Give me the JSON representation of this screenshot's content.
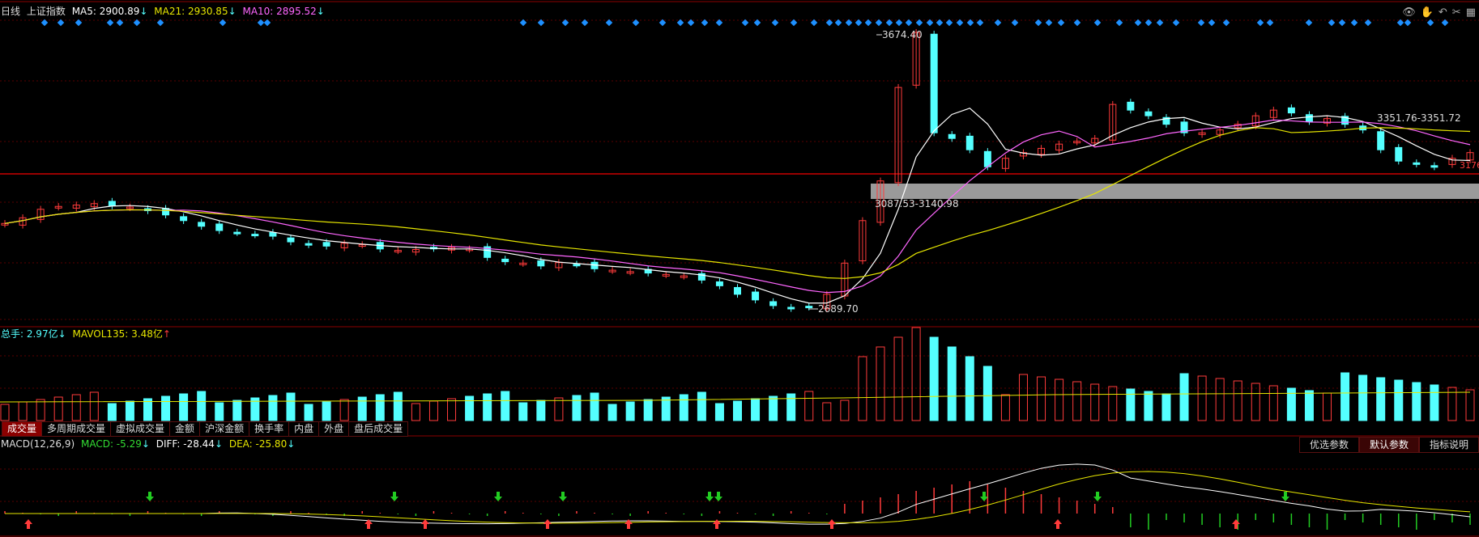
{
  "header": {
    "period": "日线",
    "index_name": "上证指数",
    "ma5_label": "MA5: 2900.89",
    "ma5_arrow": "↓",
    "ma21_label": "MA21: 2930.85",
    "ma21_arrow": "↓",
    "ma10_label": "MA10: 2895.52",
    "ma10_arrow": "↓"
  },
  "price_panel": {
    "high_label": "3674.40",
    "low_label": "2689.70",
    "gap_label": "3087.53-3140.98",
    "right_label": "3351.76-3351.72",
    "edge_label": "3176"
  },
  "volume_panel": {
    "total_label": "总手: 2.97亿",
    "total_arrow": "↓",
    "mavol_label": "MAVOL135: 3.48亿",
    "mavol_arrow": "↑"
  },
  "tabs": [
    "成交量",
    "多周期成交量",
    "虚拟成交量",
    "金额",
    "沪深金额",
    "换手率",
    "内盘",
    "外盘",
    "盘后成交量"
  ],
  "macd_panel": {
    "title": "MACD(12,26,9)",
    "macd_label": "MACD: -5.29",
    "macd_arrow": "↓",
    "diff_label": "DIFF: -28.44",
    "diff_arrow": "↓",
    "dea_label": "DEA: -25.80",
    "dea_arrow": "↓"
  },
  "param_buttons": {
    "optimize": "优选参数",
    "default": "默认参数",
    "explain": "指标说明"
  },
  "colors": {
    "up": "#ff3b3b",
    "down": "#54ffff",
    "ma5": "#ffffff",
    "ma10": "#ff66ff",
    "ma21": "#e6e600",
    "signal": "#1e90ff",
    "grid": "#5a0000"
  },
  "chart_data": {
    "type": "candlestick",
    "approx_closes": [
      3000,
      3020,
      3050,
      3060,
      3065,
      3070,
      3062,
      3058,
      3045,
      3030,
      3010,
      2990,
      2975,
      2968,
      2960,
      2955,
      2935,
      2925,
      2920,
      2930,
      2925,
      2910,
      2905,
      2908,
      2912,
      2915,
      2910,
      2880,
      2865,
      2860,
      2850,
      2862,
      2855,
      2840,
      2835,
      2830,
      2825,
      2820,
      2815,
      2800,
      2780,
      2750,
      2730,
      2710,
      2700,
      2705,
      2750,
      2860,
      3010,
      3150,
      3480,
      3674,
      3320,
      3300,
      3260,
      3200,
      3230,
      3250,
      3265,
      3280,
      3290,
      3300,
      3420,
      3400,
      3380,
      3350,
      3320,
      3320,
      3330,
      3350,
      3380,
      3400,
      3390,
      3360,
      3370,
      3350,
      3330,
      3260,
      3220,
      3210,
      3200,
      3230,
      3250
    ]
  }
}
